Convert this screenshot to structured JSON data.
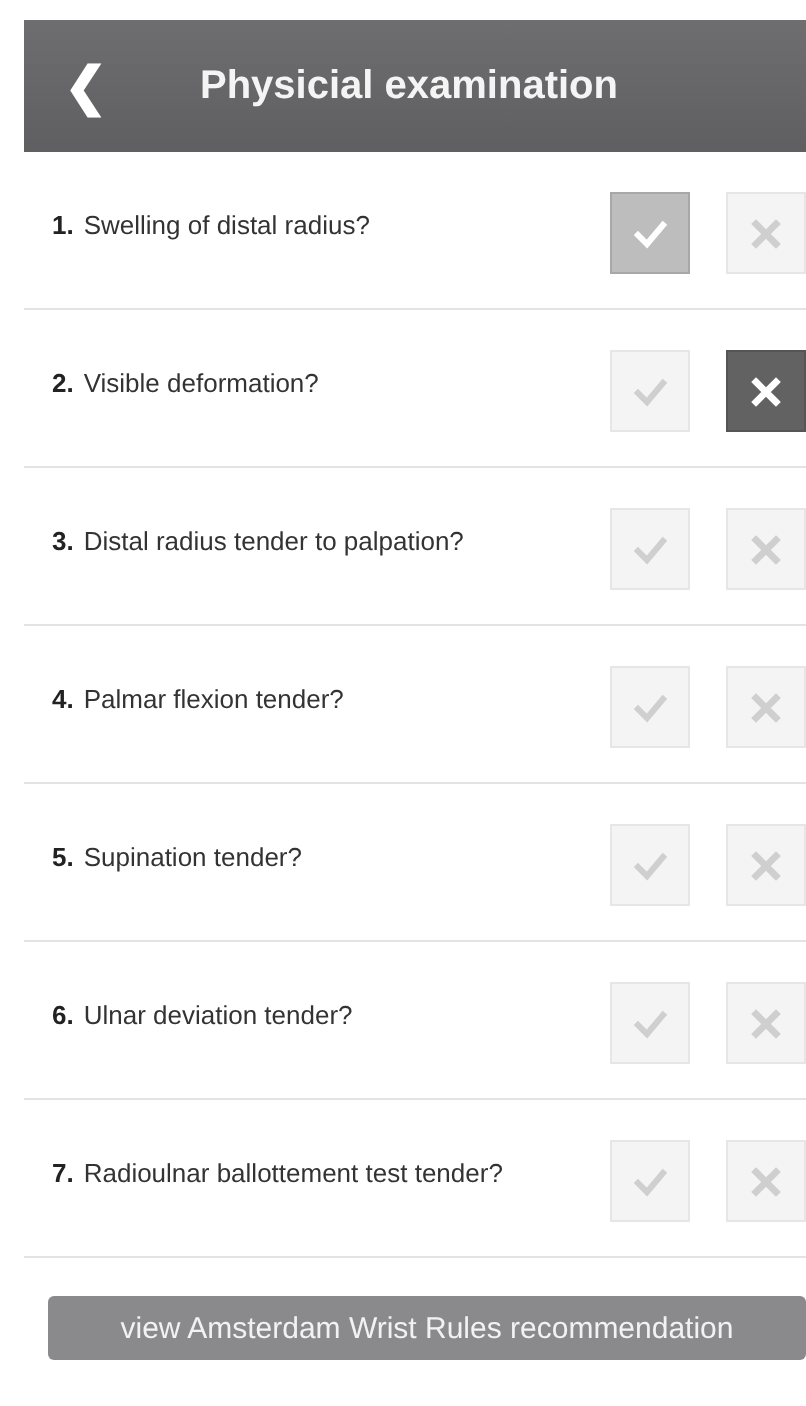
{
  "header": {
    "back": "❮",
    "title": "Physicial examination"
  },
  "questions": [
    {
      "number": "1.",
      "text": "Swelling of distal radius?",
      "yes": {
        "selected": true
      },
      "no": {
        "selected": false
      }
    },
    {
      "number": "2.",
      "text": "Visible deformation?",
      "yes": {
        "selected": false
      },
      "no": {
        "selected": true
      }
    },
    {
      "number": "3.",
      "text": "Distal radius tender to palpation?",
      "yes": {
        "selected": false
      },
      "no": {
        "selected": false
      }
    },
    {
      "number": "4.",
      "text": "Palmar flexion tender?",
      "yes": {
        "selected": false
      },
      "no": {
        "selected": false
      }
    },
    {
      "number": "5.",
      "text": "Supination tender?",
      "yes": {
        "selected": false
      },
      "no": {
        "selected": false
      }
    },
    {
      "number": "6.",
      "text": "Ulnar deviation tender?",
      "yes": {
        "selected": false
      },
      "no": {
        "selected": false
      }
    },
    {
      "number": "7.",
      "text": "Radioulnar ballottement test tender?",
      "yes": {
        "selected": false
      },
      "no": {
        "selected": false
      }
    }
  ],
  "action_button": "view Amsterdam Wrist Rules recommendation"
}
